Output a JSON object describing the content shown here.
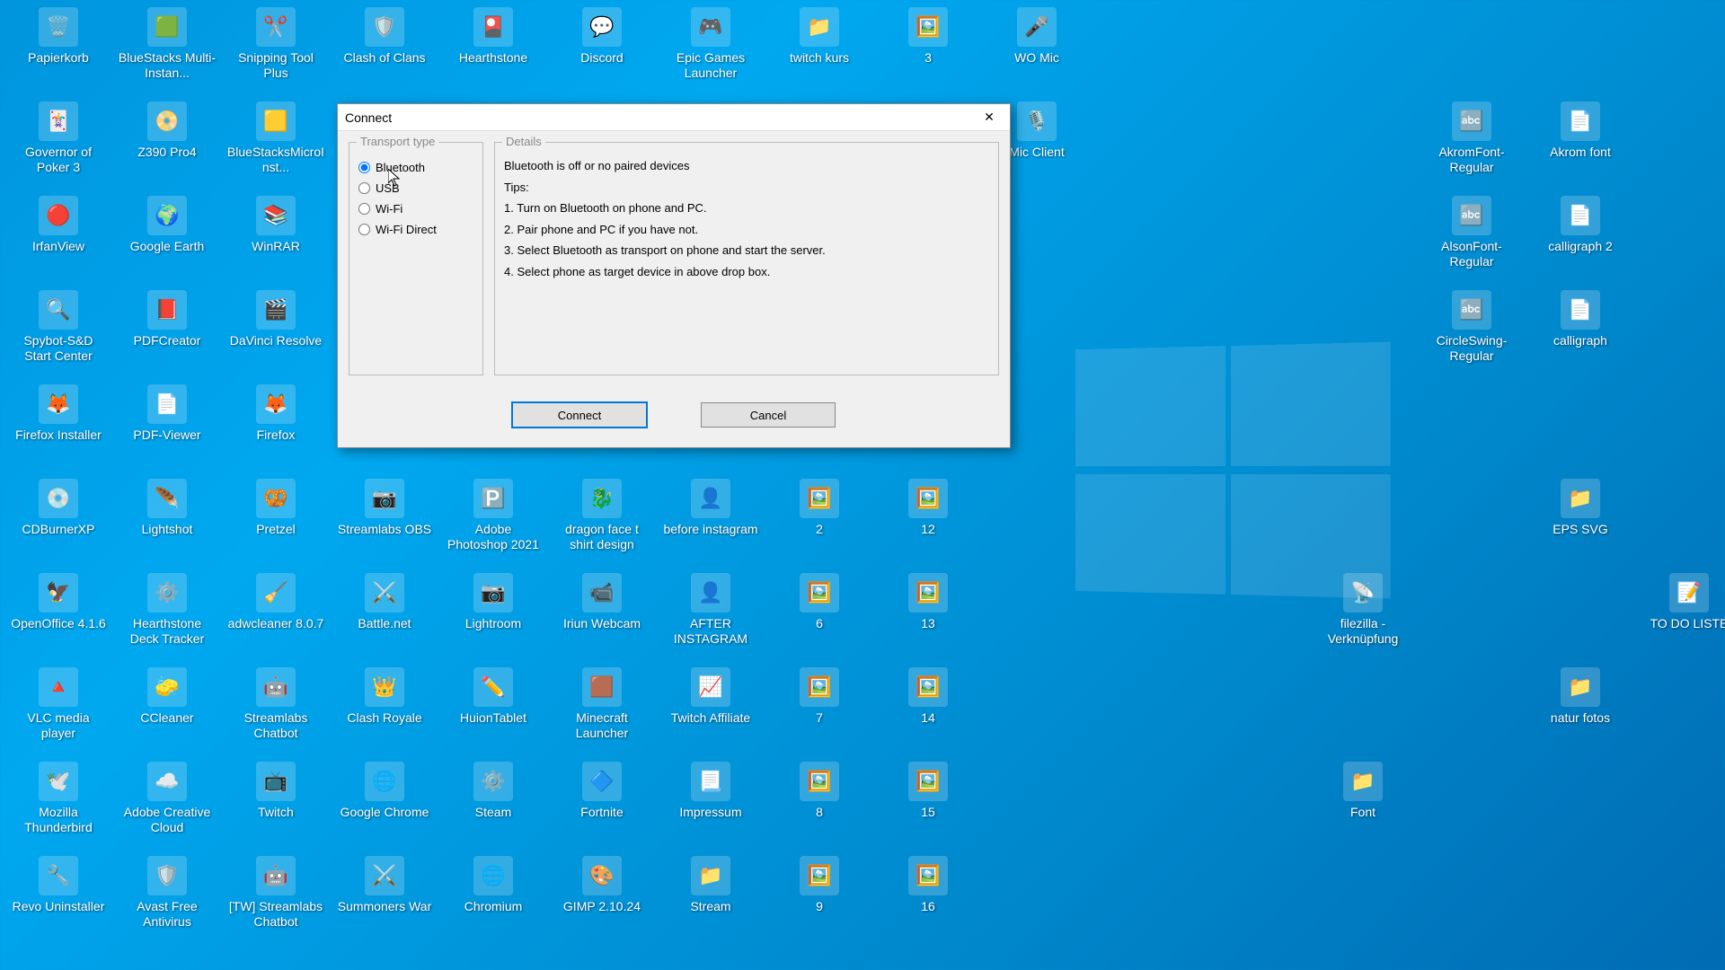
{
  "desktop_icons": [
    {
      "row": 0,
      "col": 0,
      "label": "Papierkorb",
      "emoji": "🗑️"
    },
    {
      "row": 0,
      "col": 1,
      "label": "BlueStacks Multi-Instan...",
      "emoji": "🟩"
    },
    {
      "row": 0,
      "col": 2,
      "label": "Snipping Tool Plus",
      "emoji": "✂️"
    },
    {
      "row": 0,
      "col": 3,
      "label": "Clash of Clans",
      "emoji": "🛡️"
    },
    {
      "row": 0,
      "col": 4,
      "label": "Hearthstone",
      "emoji": "🎴"
    },
    {
      "row": 0,
      "col": 5,
      "label": "Discord",
      "emoji": "💬"
    },
    {
      "row": 0,
      "col": 6,
      "label": "Epic Games Launcher",
      "emoji": "🎮"
    },
    {
      "row": 0,
      "col": 7,
      "label": "twitch kurs",
      "emoji": "📁"
    },
    {
      "row": 0,
      "col": 8,
      "label": "3",
      "emoji": "🖼️"
    },
    {
      "row": 0,
      "col": 9,
      "label": "WO Mic",
      "emoji": "🎤"
    },
    {
      "row": 1,
      "col": 0,
      "label": "Governor of Poker 3",
      "emoji": "🃏"
    },
    {
      "row": 1,
      "col": 1,
      "label": "Z390 Pro4",
      "emoji": "📀"
    },
    {
      "row": 1,
      "col": 2,
      "label": "BlueStacksMicroInst...",
      "emoji": "🟨"
    },
    {
      "row": 1,
      "col": 9,
      "label": "Mic Client",
      "emoji": "🎙️"
    },
    {
      "row": 1,
      "col": 13,
      "label": "AkromFont-Regular",
      "emoji": "🔤"
    },
    {
      "row": 1,
      "col": 14,
      "label": "Akrom font",
      "emoji": "📄"
    },
    {
      "row": 2,
      "col": 0,
      "label": "IrfanView",
      "emoji": "🔴"
    },
    {
      "row": 2,
      "col": 1,
      "label": "Google Earth",
      "emoji": "🌍"
    },
    {
      "row": 2,
      "col": 2,
      "label": "WinRAR",
      "emoji": "📚"
    },
    {
      "row": 2,
      "col": 13,
      "label": "AlsonFont-Regular",
      "emoji": "🔤"
    },
    {
      "row": 2,
      "col": 14,
      "label": "calligraph 2",
      "emoji": "📄"
    },
    {
      "row": 3,
      "col": 0,
      "label": "Spybot-S&D Start Center",
      "emoji": "🔍"
    },
    {
      "row": 3,
      "col": 1,
      "label": "PDFCreator",
      "emoji": "📕"
    },
    {
      "row": 3,
      "col": 2,
      "label": "DaVinci Resolve",
      "emoji": "🎬"
    },
    {
      "row": 3,
      "col": 13,
      "label": "CircleSwing-Regular",
      "emoji": "🔤"
    },
    {
      "row": 3,
      "col": 14,
      "label": "calligraph",
      "emoji": "📄"
    },
    {
      "row": 4,
      "col": 0,
      "label": "Firefox Installer",
      "emoji": "🦊"
    },
    {
      "row": 4,
      "col": 1,
      "label": "PDF-Viewer",
      "emoji": "📄"
    },
    {
      "row": 4,
      "col": 2,
      "label": "Firefox",
      "emoji": "🦊"
    },
    {
      "row": 5,
      "col": 0,
      "label": "CDBurnerXP",
      "emoji": "💿"
    },
    {
      "row": 5,
      "col": 1,
      "label": "Lightshot",
      "emoji": "🪶"
    },
    {
      "row": 5,
      "col": 2,
      "label": "Pretzel",
      "emoji": "🥨"
    },
    {
      "row": 5,
      "col": 3,
      "label": "Streamlabs OBS",
      "emoji": "📷"
    },
    {
      "row": 5,
      "col": 4,
      "label": "Adobe Photoshop 2021",
      "emoji": "🅿️"
    },
    {
      "row": 5,
      "col": 5,
      "label": "dragon face t shirt design",
      "emoji": "🐉"
    },
    {
      "row": 5,
      "col": 6,
      "label": "before instagram",
      "emoji": "👤"
    },
    {
      "row": 5,
      "col": 7,
      "label": "2",
      "emoji": "🖼️"
    },
    {
      "row": 5,
      "col": 8,
      "label": "12",
      "emoji": "🖼️"
    },
    {
      "row": 5,
      "col": 14,
      "label": "EPS SVG",
      "emoji": "📁"
    },
    {
      "row": 6,
      "col": 0,
      "label": "OpenOffice 4.1.6",
      "emoji": "🦅"
    },
    {
      "row": 6,
      "col": 1,
      "label": "Hearthstone Deck Tracker",
      "emoji": "⚙️"
    },
    {
      "row": 6,
      "col": 2,
      "label": "adwcleaner 8.0.7",
      "emoji": "🧹"
    },
    {
      "row": 6,
      "col": 3,
      "label": "Battle.net",
      "emoji": "⚔️"
    },
    {
      "row": 6,
      "col": 4,
      "label": "Lightroom",
      "emoji": "📷"
    },
    {
      "row": 6,
      "col": 5,
      "label": "Iriun Webcam",
      "emoji": "📹"
    },
    {
      "row": 6,
      "col": 6,
      "label": "AFTER INSTAGRAM",
      "emoji": "👤"
    },
    {
      "row": 6,
      "col": 7,
      "label": "6",
      "emoji": "🖼️"
    },
    {
      "row": 6,
      "col": 8,
      "label": "13",
      "emoji": "🖼️"
    },
    {
      "row": 6,
      "col": 12,
      "label": "filezilla - Verknüpfung",
      "emoji": "📡"
    },
    {
      "row": 6,
      "col": 15,
      "label": "TO DO LISTE",
      "emoji": "📝"
    },
    {
      "row": 7,
      "col": 0,
      "label": "VLC media player",
      "emoji": "🔺"
    },
    {
      "row": 7,
      "col": 1,
      "label": "CCleaner",
      "emoji": "🧽"
    },
    {
      "row": 7,
      "col": 2,
      "label": "Streamlabs Chatbot",
      "emoji": "🤖"
    },
    {
      "row": 7,
      "col": 3,
      "label": "Clash Royale",
      "emoji": "👑"
    },
    {
      "row": 7,
      "col": 4,
      "label": "HuionTablet",
      "emoji": "✏️"
    },
    {
      "row": 7,
      "col": 5,
      "label": "Minecraft Launcher",
      "emoji": "🟫"
    },
    {
      "row": 7,
      "col": 6,
      "label": "Twitch Affiliate",
      "emoji": "📈"
    },
    {
      "row": 7,
      "col": 7,
      "label": "7",
      "emoji": "🖼️"
    },
    {
      "row": 7,
      "col": 8,
      "label": "14",
      "emoji": "🖼️"
    },
    {
      "row": 7,
      "col": 14,
      "label": "natur fotos",
      "emoji": "📁"
    },
    {
      "row": 8,
      "col": 0,
      "label": "Mozilla Thunderbird",
      "emoji": "🕊️"
    },
    {
      "row": 8,
      "col": 1,
      "label": "Adobe Creative Cloud",
      "emoji": "☁️"
    },
    {
      "row": 8,
      "col": 2,
      "label": "Twitch",
      "emoji": "📺"
    },
    {
      "row": 8,
      "col": 3,
      "label": "Google Chrome",
      "emoji": "🌐"
    },
    {
      "row": 8,
      "col": 4,
      "label": "Steam",
      "emoji": "⚙️"
    },
    {
      "row": 8,
      "col": 5,
      "label": "Fortnite",
      "emoji": "🔷"
    },
    {
      "row": 8,
      "col": 6,
      "label": "Impressum",
      "emoji": "📃"
    },
    {
      "row": 8,
      "col": 7,
      "label": "8",
      "emoji": "🖼️"
    },
    {
      "row": 8,
      "col": 8,
      "label": "15",
      "emoji": "🖼️"
    },
    {
      "row": 8,
      "col": 12,
      "label": "Font",
      "emoji": "📁"
    },
    {
      "row": 9,
      "col": 0,
      "label": "Revo Uninstaller",
      "emoji": "🔧"
    },
    {
      "row": 9,
      "col": 1,
      "label": "Avast Free Antivirus",
      "emoji": "🛡️"
    },
    {
      "row": 9,
      "col": 2,
      "label": "[TW] Streamlabs Chatbot",
      "emoji": "🤖"
    },
    {
      "row": 9,
      "col": 3,
      "label": "Summoners War",
      "emoji": "⚔️"
    },
    {
      "row": 9,
      "col": 4,
      "label": "Chromium",
      "emoji": "🌐"
    },
    {
      "row": 9,
      "col": 5,
      "label": "GIMP 2.10.24",
      "emoji": "🎨"
    },
    {
      "row": 9,
      "col": 6,
      "label": "Stream",
      "emoji": "📁"
    },
    {
      "row": 9,
      "col": 7,
      "label": "9",
      "emoji": "🖼️"
    },
    {
      "row": 9,
      "col": 8,
      "label": "16",
      "emoji": "🖼️"
    }
  ],
  "dialog": {
    "title": "Connect",
    "close": "✕",
    "transport_legend": "Transport type",
    "details_legend": "Details",
    "radios": {
      "bluetooth": "Bluetooth",
      "usb": "USB",
      "wifi": "Wi-Fi",
      "wifi_direct": "Wi-Fi Direct"
    },
    "selected_radio": "bluetooth",
    "details_msg": "Bluetooth is off or no paired devices",
    "tips_heading": "Tips:",
    "tips": [
      "1. Turn on Bluetooth on phone and PC.",
      "2. Pair phone and PC if you have not.",
      "3. Select Bluetooth as transport on phone and start the server.",
      "4. Select phone as target device in above drop box."
    ],
    "btn_connect": "Connect",
    "btn_cancel": "Cancel"
  }
}
